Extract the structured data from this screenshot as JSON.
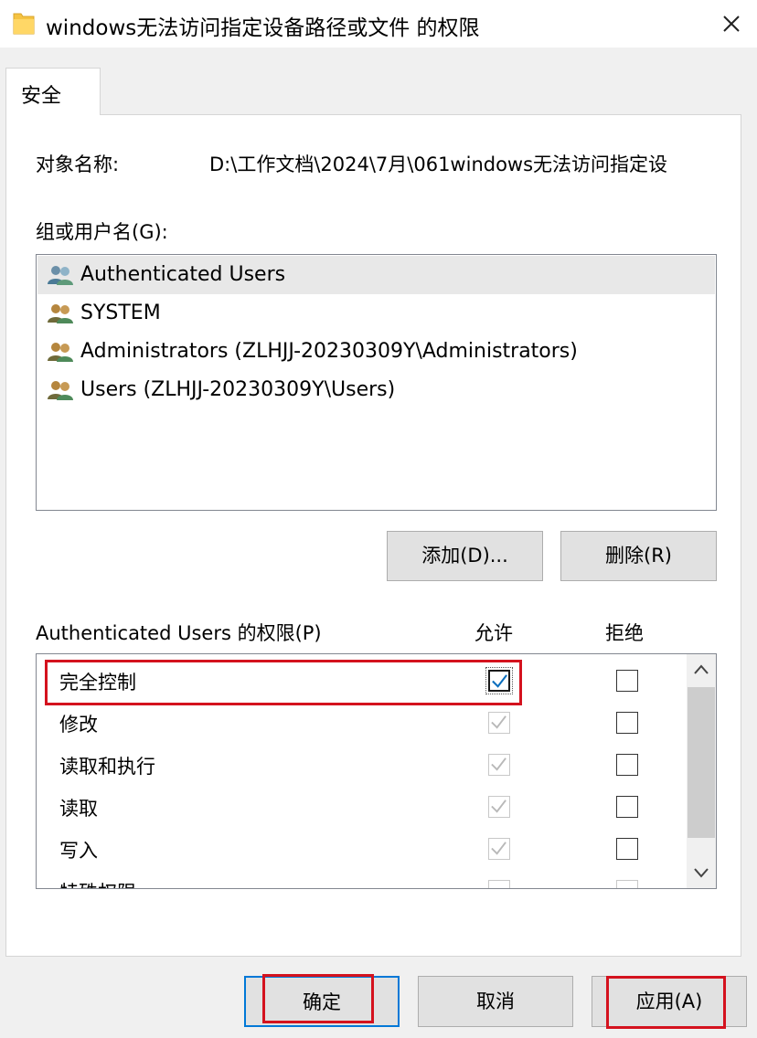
{
  "window": {
    "title": "windows无法访问指定设备路径或文件 的权限",
    "close_icon": "close-icon",
    "folder_icon": "folder-icon",
    "folder_color": "#f5c342"
  },
  "tabs": [
    {
      "label": "安全"
    }
  ],
  "object": {
    "label": "对象名称:",
    "path": "D:\\工作文档\\2024\\7月\\061windows无法访问指定设"
  },
  "groups": {
    "label": "组或用户名(G):",
    "items": [
      {
        "name": "Authenticated Users",
        "selected": true,
        "icon": "users-icon"
      },
      {
        "name": "SYSTEM",
        "selected": false,
        "icon": "users-icon"
      },
      {
        "name": "Administrators (ZLHJJ-20230309Y\\Administrators)",
        "selected": false,
        "icon": "users-icon"
      },
      {
        "name": "Users (ZLHJJ-20230309Y\\Users)",
        "selected": false,
        "icon": "users-icon"
      }
    ],
    "add_label": "添加(D)...",
    "remove_label": "删除(R)"
  },
  "permissions": {
    "label": "Authenticated Users 的权限(P)",
    "allow_header": "允许",
    "deny_header": "拒绝",
    "rows": [
      {
        "name": "完全控制",
        "allow": true,
        "allow_enabled": true,
        "deny": false
      },
      {
        "name": "修改",
        "allow": true,
        "allow_enabled": false,
        "deny": false
      },
      {
        "name": "读取和执行",
        "allow": true,
        "allow_enabled": false,
        "deny": false
      },
      {
        "name": "读取",
        "allow": true,
        "allow_enabled": false,
        "deny": false
      },
      {
        "name": "写入",
        "allow": true,
        "allow_enabled": false,
        "deny": false
      },
      {
        "name": "特殊权限",
        "allow": false,
        "allow_enabled": false,
        "deny": false
      }
    ]
  },
  "buttons": {
    "ok": "确定",
    "cancel": "取消",
    "apply": "应用(A)"
  },
  "colors": {
    "accent": "#0078d7",
    "highlight": "#d4121e",
    "check_enabled": "#0a6ebd",
    "check_disabled": "#b8b8b8"
  }
}
